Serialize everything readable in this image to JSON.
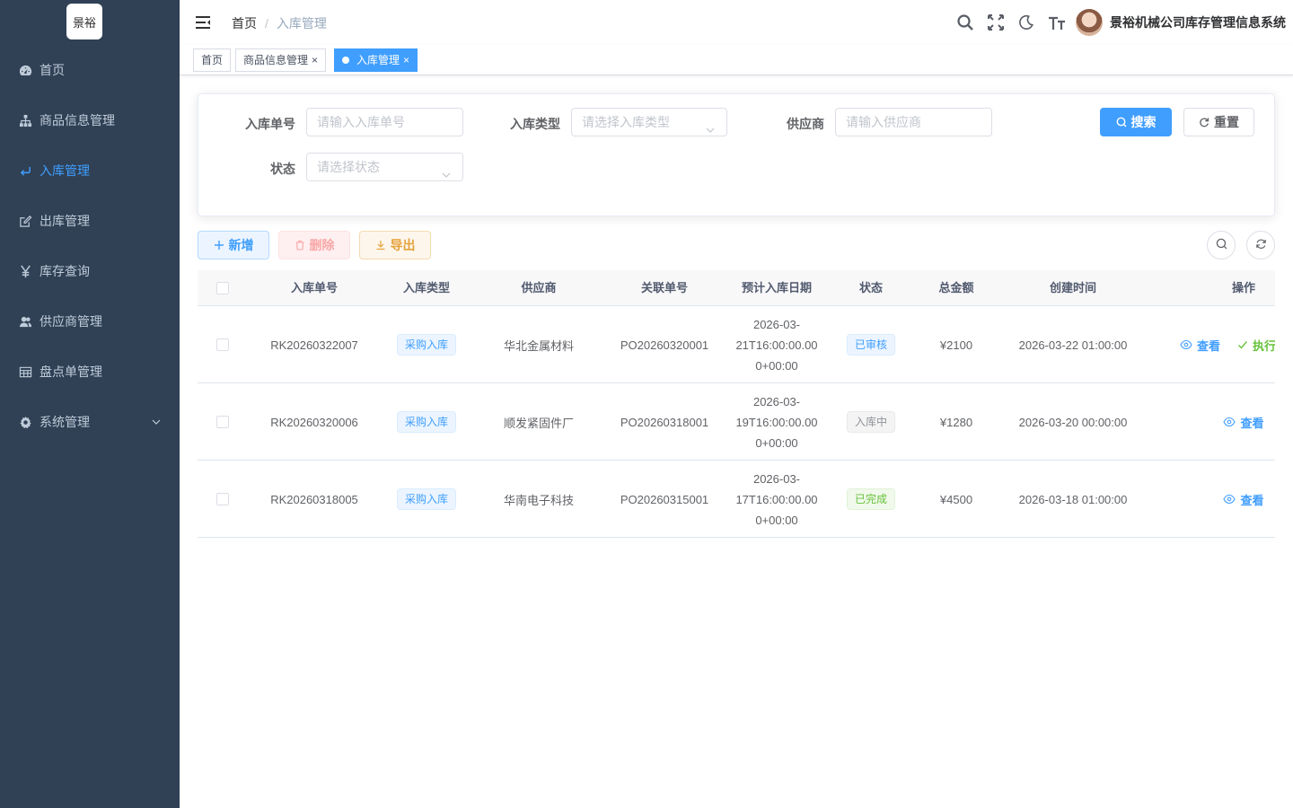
{
  "sidebar": {
    "logo_text": "景裕",
    "items": [
      {
        "label": "首页",
        "icon": "dashboard-icon",
        "active": false
      },
      {
        "label": "商品信息管理",
        "icon": "tree-icon",
        "active": false
      },
      {
        "label": "入库管理",
        "icon": "enter-icon",
        "active": true
      },
      {
        "label": "出库管理",
        "icon": "edit-icon",
        "active": false
      },
      {
        "label": "库存查询",
        "icon": "yen-icon",
        "active": false
      },
      {
        "label": "供应商管理",
        "icon": "peoples-icon",
        "active": false
      },
      {
        "label": "盘点单管理",
        "icon": "table-icon",
        "active": false
      },
      {
        "label": "系统管理",
        "icon": "gear-icon",
        "active": false
      }
    ]
  },
  "navbar": {
    "breadcrumb": {
      "home": "首页",
      "separator": "/",
      "current": "入库管理"
    },
    "system_name": "景裕机械公司库存管理信息系统"
  },
  "tags": [
    {
      "label": "首页",
      "active": false
    },
    {
      "label": "商品信息管理",
      "active": false
    },
    {
      "label": "入库管理",
      "active": true
    }
  ],
  "search": {
    "fields": {
      "order_no": {
        "label": "入库单号",
        "placeholder": "请输入入库单号"
      },
      "type": {
        "label": "入库类型",
        "placeholder": "请选择入库类型"
      },
      "supplier": {
        "label": "供应商",
        "placeholder": "请输入供应商"
      },
      "status": {
        "label": "状态",
        "placeholder": "请选择状态"
      }
    },
    "search_label": "搜索",
    "reset_label": "重置"
  },
  "toolbar": {
    "add_label": "新增",
    "delete_label": "删除",
    "export_label": "导出"
  },
  "table": {
    "columns": [
      "入库单号",
      "入库类型",
      "供应商",
      "关联单号",
      "预计入库日期",
      "状态",
      "总金额",
      "创建时间",
      "操作"
    ],
    "rows": [
      {
        "order_no": "RK20260322007",
        "type": "采购入库",
        "supplier": "华北金属材料",
        "related_no": "PO20260320001",
        "expected_date": [
          "2026-03-",
          "21T16:00:00.00",
          "0+00:00"
        ],
        "status": "已审核",
        "status_color": "#409eff",
        "amount": "¥2100",
        "created": "2026-03-22 01:00:00",
        "actions": {
          "view": "查看",
          "execute": "执行"
        }
      },
      {
        "order_no": "RK20260320006",
        "type": "采购入库",
        "supplier": "顺发紧固件厂",
        "related_no": "PO20260318001",
        "expected_date": [
          "2026-03-",
          "19T16:00:00.00",
          "0+00:00"
        ],
        "status": "入库中",
        "status_color": "#909399",
        "amount": "¥1280",
        "created": "2026-03-20 00:00:00",
        "actions": {
          "view": "查看"
        }
      },
      {
        "order_no": "RK20260318005",
        "type": "采购入库",
        "supplier": "华南电子科技",
        "related_no": "PO20260315001",
        "expected_date": [
          "2026-03-",
          "17T16:00:00.00",
          "0+00:00"
        ],
        "status": "已完成",
        "status_color": "#67c23a",
        "amount": "¥4500",
        "created": "2026-03-18 01:00:00",
        "actions": {
          "view": "查看"
        }
      }
    ]
  },
  "colors": {
    "sidebar_bg": "#304156",
    "primary": "#409eff",
    "success": "#67c23a",
    "info": "#909399",
    "warning": "#e6a23c",
    "danger": "#f56c6c"
  }
}
